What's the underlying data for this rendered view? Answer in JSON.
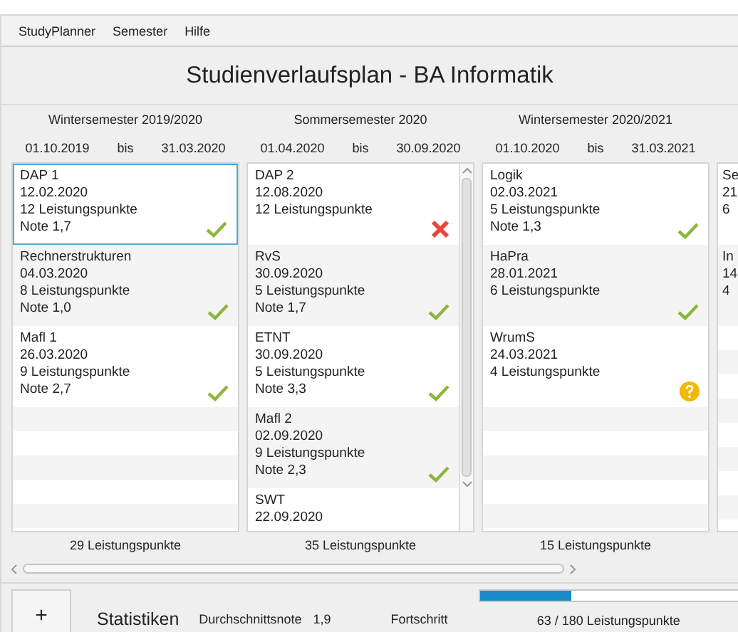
{
  "menu": [
    "StudyPlanner",
    "Semester",
    "Hilfe"
  ],
  "title": "Studienverlaufsplan - BA Informatik",
  "semesters": [
    {
      "name": "Wintersemester 2019/2020",
      "start": "01.10.2019",
      "separator": "bis",
      "end": "31.03.2020",
      "total": "29 Leistungspunkte",
      "modules": [
        {
          "lines": [
            "DAP 1",
            "12.02.2020",
            "12 Leistungspunkte",
            "Note 1,7"
          ],
          "kind": "passed",
          "selected": true
        },
        {
          "lines": [
            "Rechnerstrukturen",
            "04.03.2020",
            "8 Leistungspunkte",
            "Note 1,0"
          ],
          "kind": "passed",
          "selected": false
        },
        {
          "lines": [
            "Mafl 1",
            "26.03.2020",
            "9 Leistungspunkte",
            "Note 2,7"
          ],
          "kind": "passed",
          "selected": false
        }
      ]
    },
    {
      "name": "Sommersemester 2020",
      "start": "01.04.2020",
      "separator": "bis",
      "end": "30.09.2020",
      "scrollbar": true,
      "total": "35 Leistungspunkte",
      "modules": [
        {
          "lines": [
            "DAP 2",
            "12.08.2020",
            "12 Leistungspunkte"
          ],
          "kind": "failed",
          "selected": false
        },
        {
          "lines": [
            "RvS",
            "30.09.2020",
            "5 Leistungspunkte",
            "Note 1,7"
          ],
          "kind": "passed",
          "selected": false
        },
        {
          "lines": [
            "ETNT",
            "30.09.2020",
            "5 Leistungspunkte",
            "Note 3,3"
          ],
          "kind": "passed",
          "selected": false
        },
        {
          "lines": [
            "Mafl 2",
            "02.09.2020",
            "9 Leistungspunkte",
            "Note 2,3"
          ],
          "kind": "passed",
          "selected": false
        },
        {
          "lines": [
            "SWT",
            "22.09.2020"
          ],
          "selected": false
        }
      ]
    },
    {
      "name": "Wintersemester 2020/2021",
      "start": "01.10.2020",
      "separator": "bis",
      "end": "31.03.2021",
      "total": "15 Leistungspunkte",
      "modules": [
        {
          "lines": [
            "Logik",
            "02.03.2021",
            "5 Leistungspunkte",
            "Note 1,3"
          ],
          "kind": "passed",
          "selected": false
        },
        {
          "lines": [
            "HaPra",
            "28.01.2021",
            "6 Leistungspunkte"
          ],
          "kind": "passed",
          "selected": false
        },
        {
          "lines": [
            "WrumS",
            "24.03.2021",
            "4 Leistungspunkte"
          ],
          "kind": "pending",
          "selected": false
        }
      ]
    },
    {
      "modules": [
        {
          "lines": [
            "Se",
            "21",
            "6"
          ],
          "selected": false
        },
        {
          "lines": [
            "In",
            "14",
            "4"
          ],
          "selected": false
        }
      ]
    }
  ],
  "add_button": "+",
  "stats": {
    "heading": "Statistiken",
    "average_label": "Durchschnittsnote",
    "average": "1,9",
    "progress_label": "Fortschritt",
    "level": 0.35,
    "progress_text": "63 / 180 Leistungspunkte"
  }
}
